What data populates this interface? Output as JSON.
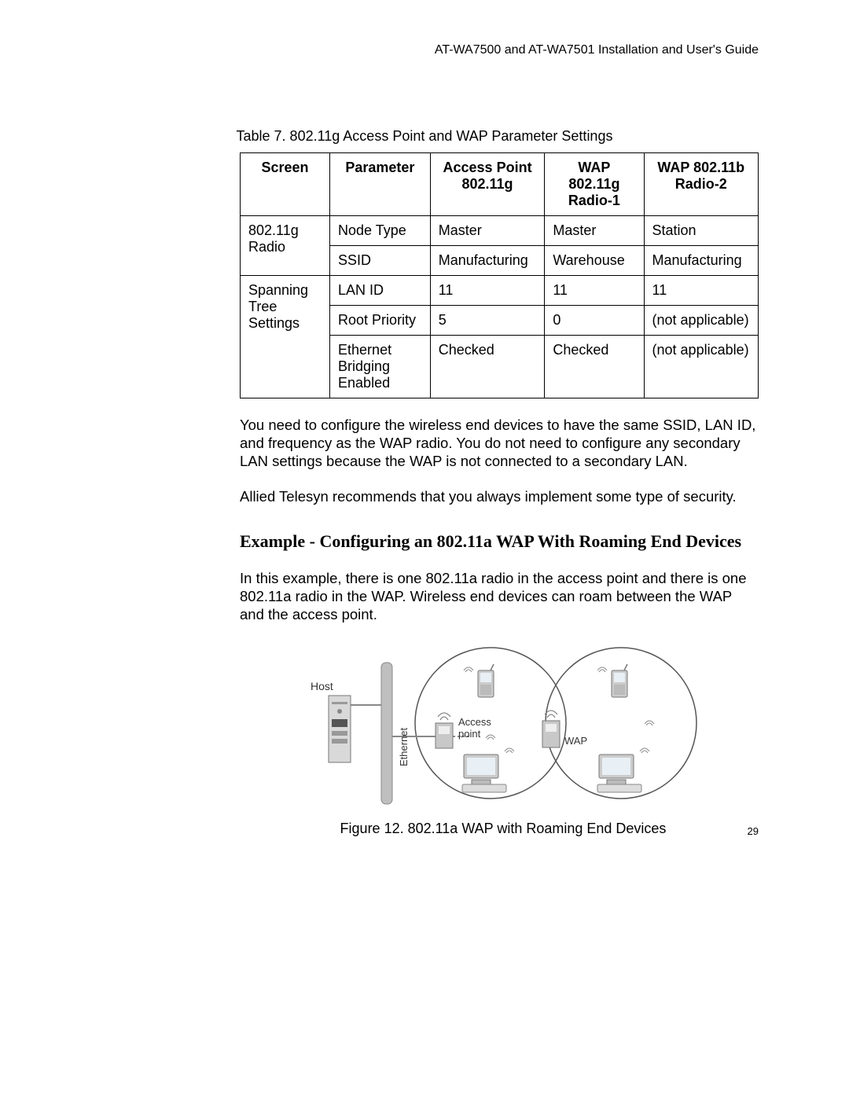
{
  "header": "AT-WA7500 and AT-WA7501 Installation and User's Guide",
  "table_caption": "Table 7. 802.11g Access Point and WAP Parameter Settings",
  "table": {
    "headers": {
      "screen": "Screen",
      "parameter": "Parameter",
      "ap": "Access Point 802.11g",
      "wap1": "WAP 802.11g Radio-1",
      "wap2": "WAP 802.11b Radio-2"
    },
    "rows": {
      "r1": {
        "screen": "802.11g Radio",
        "param": "Node Type",
        "ap": "Master",
        "wap1": "Master",
        "wap2": "Station"
      },
      "r2": {
        "param": "SSID",
        "ap": "Manufacturing",
        "wap1": "Warehouse",
        "wap2": "Manufacturing"
      },
      "r3": {
        "screen": "Spanning Tree Settings",
        "param": "LAN ID",
        "ap": "11",
        "wap1": "11",
        "wap2": "11"
      },
      "r4": {
        "param": "Root Priority",
        "ap": "5",
        "wap1": "0",
        "wap2": "(not applicable)"
      },
      "r5": {
        "param": "Ethernet Bridging Enabled",
        "ap": "Checked",
        "wap1": "Checked",
        "wap2": "(not applicable)"
      }
    }
  },
  "para1": "You need to configure the wireless end devices to have the same SSID, LAN ID, and frequency as the WAP radio. You do not need to configure any secondary LAN settings because the WAP is not connected to a secondary LAN.",
  "para2": "Allied Telesyn recommends that you always implement some type of security.",
  "section_heading": "Example - Configuring an 802.11a WAP With Roaming End Devices",
  "para3": "In this example, there is one 802.11a radio in the access point and there is one 802.11a radio in the WAP. Wireless end devices can roam between the WAP and the access point.",
  "figure": {
    "labels": {
      "host": "Host",
      "ethernet": "Ethernet",
      "access_point": "Access point",
      "wap": "WAP"
    },
    "caption": "Figure 12. 802.11a WAP with Roaming End Devices"
  },
  "page_number": "29"
}
